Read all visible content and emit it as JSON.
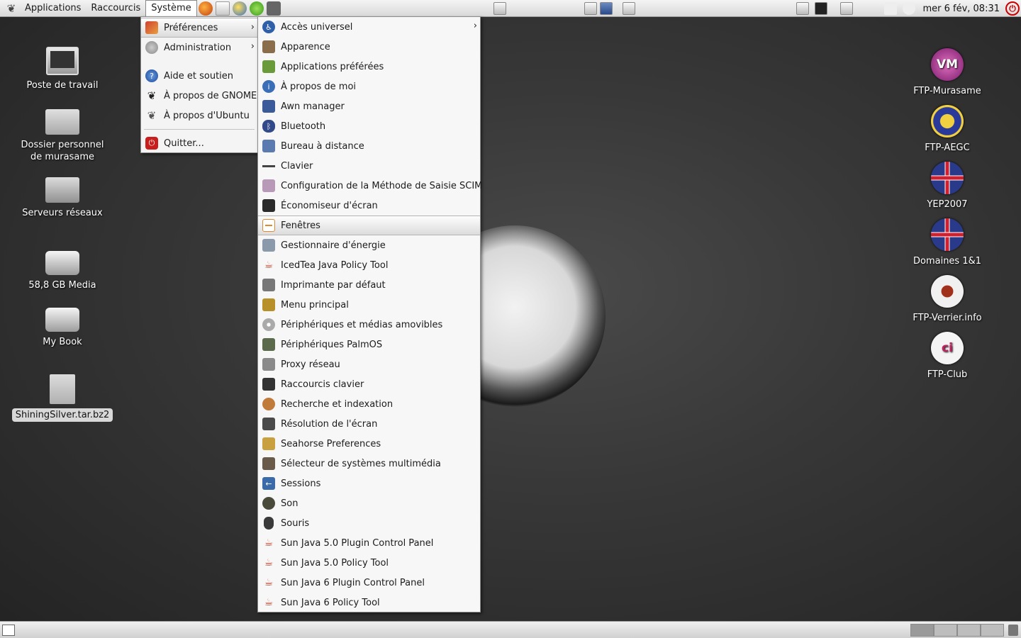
{
  "top_panel": {
    "menus": [
      "Applications",
      "Raccourcis",
      "Système"
    ],
    "clock": "mer  6 fév, 08:31"
  },
  "system_menu": {
    "items": [
      {
        "label": "Préférences",
        "submenu": true
      },
      {
        "label": "Administration",
        "submenu": true
      },
      {
        "label": "Aide et soutien"
      },
      {
        "label": "À propos de GNOME"
      },
      {
        "label": "À propos d'Ubuntu"
      },
      {
        "label": "Quitter..."
      }
    ]
  },
  "preferences_menu": {
    "items": [
      {
        "label": "Accès universel",
        "submenu": true,
        "color": "#2f5fa8"
      },
      {
        "label": "Apparence",
        "color": "#8a6d4a"
      },
      {
        "label": "Applications préférées",
        "color": "#6a9a3a"
      },
      {
        "label": "À propos de moi",
        "color": "#3a6fb8"
      },
      {
        "label": "Awn manager",
        "color": "#3a5a9a"
      },
      {
        "label": "Bluetooth",
        "color": "#334a8a"
      },
      {
        "label": "Bureau à distance",
        "color": "#5a7ab0"
      },
      {
        "label": "Clavier",
        "color": "#444444"
      },
      {
        "label": "Configuration de la Méthode de Saisie SCIM",
        "color": "#b89ab8"
      },
      {
        "label": "Économiseur d'écran",
        "color": "#2a2a2a"
      },
      {
        "label": "Fenêtres",
        "color": "#e08a30"
      },
      {
        "label": "Gestionnaire d'énergie",
        "color": "#8a9aaa"
      },
      {
        "label": "IcedTea Java  Policy Tool",
        "color": "#c0503a"
      },
      {
        "label": "Imprimante par défaut",
        "color": "#777777"
      },
      {
        "label": "Menu principal",
        "color": "#b8902a"
      },
      {
        "label": "Périphériques et médias amovibles",
        "color": "#aaaaaa"
      },
      {
        "label": "Périphériques PalmOS",
        "color": "#5a6a4a"
      },
      {
        "label": "Proxy réseau",
        "color": "#8a8a8a"
      },
      {
        "label": "Raccourcis clavier",
        "color": "#333333"
      },
      {
        "label": "Recherche et indexation",
        "color": "#c07a3a"
      },
      {
        "label": "Résolution de l'écran",
        "color": "#4a4a4a"
      },
      {
        "label": "Seahorse Preferences",
        "color": "#c8a040"
      },
      {
        "label": "Sélecteur de systèmes multimédia",
        "color": "#6a5a4a"
      },
      {
        "label": "Sessions",
        "color": "#3a6aa8"
      },
      {
        "label": "Son",
        "color": "#4a4a3a"
      },
      {
        "label": "Souris",
        "color": "#3a3a3a"
      },
      {
        "label": "Sun Java 5.0 Plugin Control Panel",
        "color": "#c0503a"
      },
      {
        "label": "Sun Java 5.0 Policy Tool",
        "color": "#c0503a"
      },
      {
        "label": "Sun Java 6 Plugin Control Panel",
        "color": "#c0503a"
      },
      {
        "label": "Sun Java 6 Policy Tool",
        "color": "#c0503a"
      }
    ],
    "highlighted": "Fenêtres"
  },
  "desktop_left": [
    {
      "label": "Poste de travail",
      "icon": "computer-icon"
    },
    {
      "label": "Dossier personnel\nde murasame",
      "line1": "Dossier personnel",
      "line2": "de murasame",
      "icon": "home-folder-icon"
    },
    {
      "label": "Serveurs réseaux",
      "icon": "network-servers-icon"
    },
    {
      "label": "58,8 GB Media",
      "icon": "drive-icon"
    },
    {
      "label": "My Book",
      "icon": "drive-icon"
    },
    {
      "label": "ShiningSilver.tar.bz2",
      "icon": "archive-file-icon",
      "selected": true
    }
  ],
  "desktop_right": [
    {
      "label": "FTP-Murasame",
      "logo": "VM",
      "color": "#9a2a8a"
    },
    {
      "label": "FTP-AEGC",
      "logo": "",
      "color": "#2a3a9a"
    },
    {
      "label": "YEP2007",
      "logo": "",
      "color": "#c0303a"
    },
    {
      "label": "Domaines 1&1",
      "logo": "",
      "color": "#c0303a"
    },
    {
      "label": "FTP-Verrier.info",
      "logo": "",
      "color": "#e8e8e8"
    },
    {
      "label": "FTP-Club",
      "logo": "ci",
      "color": "#f0f0f0"
    }
  ]
}
